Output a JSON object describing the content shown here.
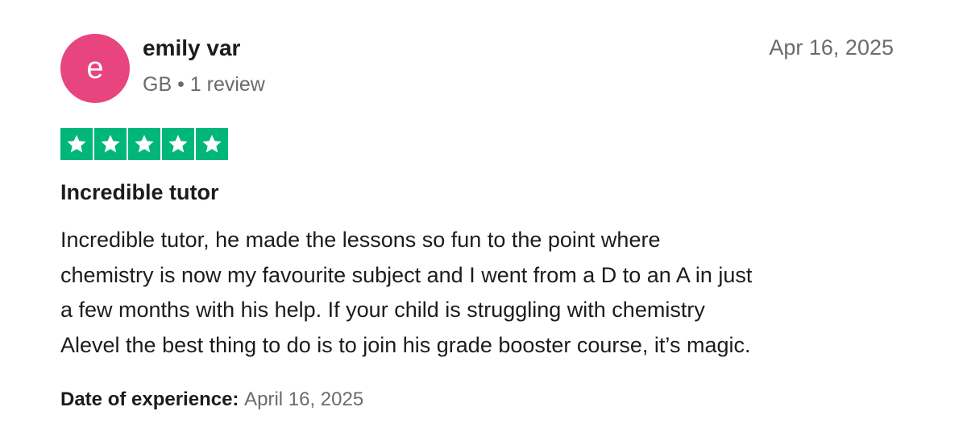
{
  "reviewer": {
    "avatar_initial": "e",
    "name": "emily var",
    "meta": "GB • 1 review"
  },
  "review": {
    "date": "Apr 16, 2025",
    "rating": 5,
    "rating_max": 5,
    "title": "Incredible tutor",
    "body_lines": [
      "Incredible tutor, he made the lessons so fun to the point where",
      "chemistry is now my favourite subject and I went from a D to an A in just",
      "a few months with his help. If your child is struggling with chemistry",
      "Alevel the best thing to do is to join his grade booster course, it’s magic."
    ],
    "experience_label": "Date of experience:",
    "experience_date": "April 16, 2025"
  },
  "colors": {
    "avatar_bg": "#e8457e",
    "star_bg": "#00b67a",
    "secondary_text": "#6b6b6b",
    "primary_text": "#1c1c1c"
  },
  "icons": {
    "star": "star-icon"
  }
}
